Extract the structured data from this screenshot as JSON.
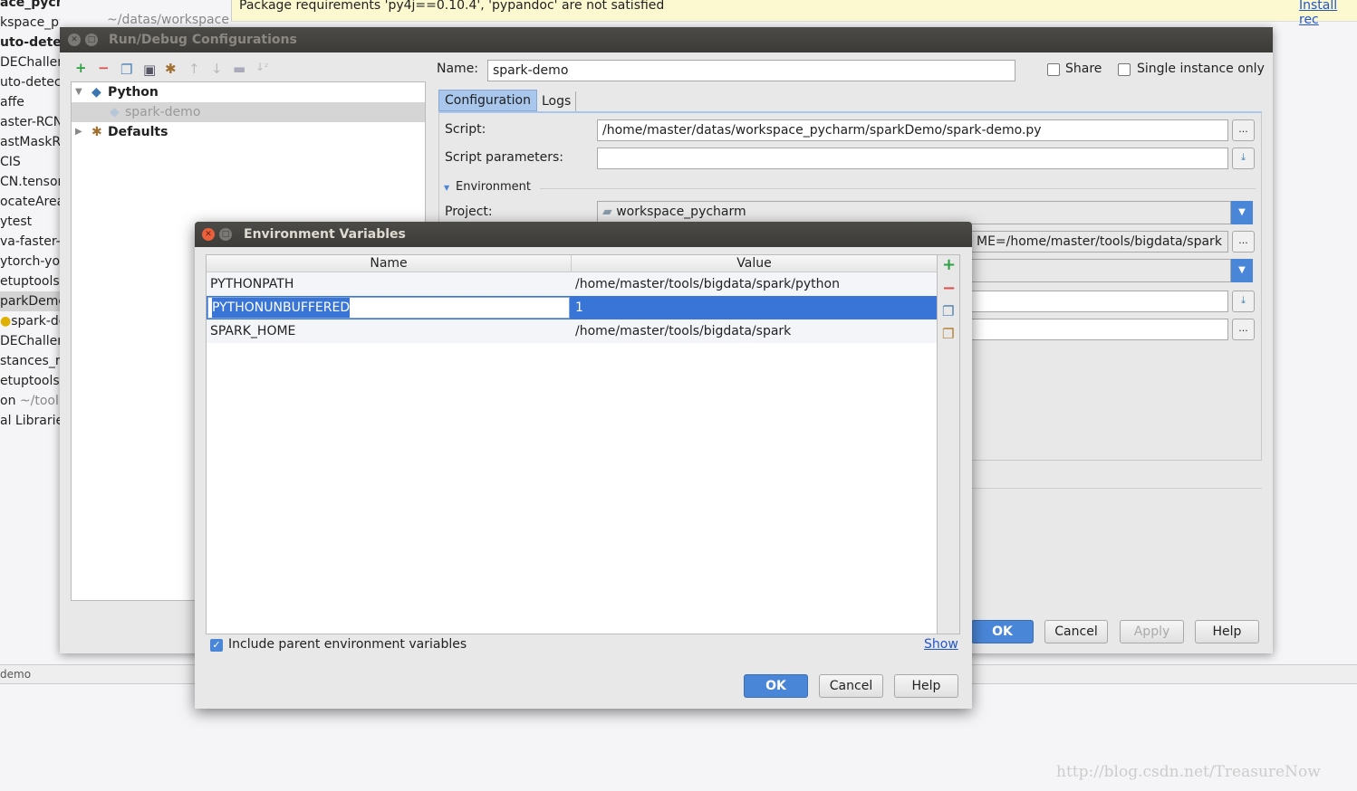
{
  "background": {
    "project_lines": [
      "ace_pycharm",
      "kspace_pycharm",
      "uto-detec",
      "DEChaller",
      "uto-detec",
      "affe",
      "aster-RCN",
      "astMaskRC",
      "CIS",
      "CN.tensor",
      "ocateArea",
      "ytest",
      "va-faster-",
      "ytorch-yo",
      "etuptools-",
      "parkDemo",
      "spark-de",
      "DEChaller",
      "stances_r",
      "etuptools-",
      "on",
      "al Libraries"
    ],
    "project_path": "~/datas/workspace",
    "tool_path": "~/tool",
    "notification": "Package requirements 'py4j==0.10.4', 'pypandoc' are not satisfied",
    "install_link": "Install rec",
    "status_bar": "demo",
    "watermark": "http://blog.csdn.net/TreasureNow"
  },
  "run_debug": {
    "title": "Run/Debug Configurations",
    "toolbar_icons": [
      "add-icon",
      "remove-icon",
      "copy-icon",
      "save-icon",
      "wrench-icon",
      "arrow-up-icon",
      "arrow-down-icon",
      "folder-icon",
      "sort-icon"
    ],
    "tree": {
      "python": "Python",
      "spark_demo": "spark-demo",
      "defaults": "Defaults"
    },
    "name_label": "Name:",
    "name_value": "spark-demo",
    "share": "Share",
    "single_instance": "Single instance only",
    "tabs": [
      "Configuration",
      "Logs"
    ],
    "script_label": "Script:",
    "script_value": "/home/master/datas/workspace_pycharm/sparkDemo/spark-demo.py",
    "params_label": "Script parameters:",
    "params_value": "",
    "environment": "Environment",
    "project_label": "Project:",
    "project_value": "workspace_pycharm",
    "env_vars_tail": "ME=/home/master/tools/bigdata/spark",
    "ok": "OK",
    "cancel": "Cancel",
    "apply": "Apply",
    "help": "Help"
  },
  "env_dialog": {
    "title": "Environment Variables",
    "columns": [
      "Name",
      "Value"
    ],
    "rows": [
      {
        "name": "PYTHONPATH",
        "value": "/home/master/tools/bigdata/spark/python"
      },
      {
        "name": "PYTHONUNBUFFERED",
        "value": "1"
      },
      {
        "name": "SPARK_HOME",
        "value": "/home/master/tools/bigdata/spark"
      }
    ],
    "selected_row": 1,
    "include_parent": "Include parent environment variables",
    "include_parent_checked": true,
    "show": "Show",
    "ok": "OK",
    "cancel": "Cancel",
    "help": "Help"
  },
  "colors": {
    "accent": "#4a86d8",
    "selection": "#3875d7",
    "add": "#2ea043",
    "remove": "#d9534f"
  }
}
